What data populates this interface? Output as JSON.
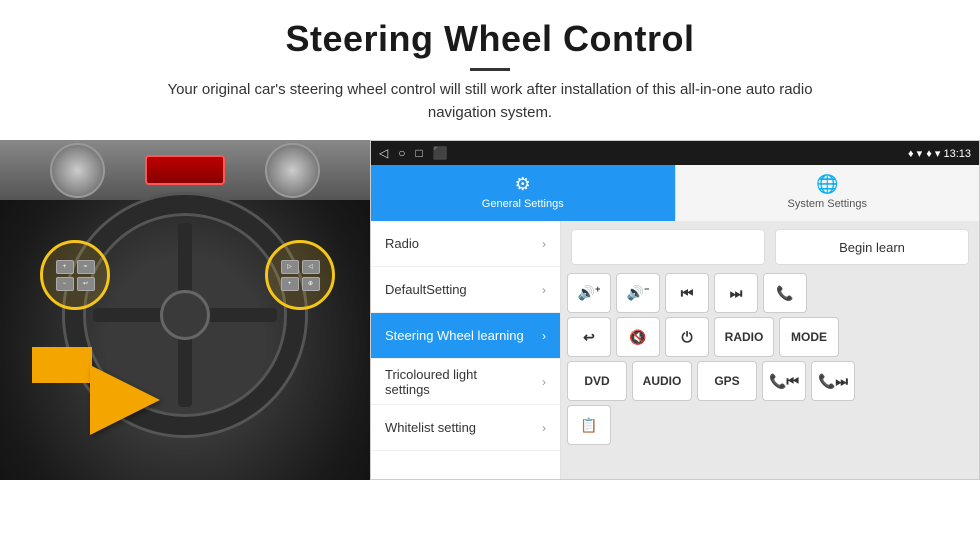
{
  "header": {
    "title": "Steering Wheel Control",
    "divider": true,
    "subtitle": "Your original car's steering wheel control will still work after installation of this all-in-one auto radio navigation system."
  },
  "android_ui": {
    "status_bar": {
      "nav_icons": [
        "◁",
        "○",
        "□",
        "⬛"
      ],
      "right": "♦ ▾ 13:13"
    },
    "tabs": [
      {
        "label": "General Settings",
        "icon": "⚙",
        "active": true
      },
      {
        "label": "System Settings",
        "icon": "🌐",
        "active": false
      }
    ],
    "menu_items": [
      {
        "label": "Radio",
        "active": false
      },
      {
        "label": "DefaultSetting",
        "active": false
      },
      {
        "label": "Steering Wheel learning",
        "active": true
      },
      {
        "label": "Tricoloured light settings",
        "active": false
      },
      {
        "label": "Whitelist setting",
        "active": false
      }
    ],
    "begin_learn_label": "Begin learn",
    "control_buttons": {
      "row1": [
        "🔊+",
        "🔊−",
        "⏮",
        "⏭",
        "📞"
      ],
      "row2": [
        "↩",
        "🔊✕",
        "⏻",
        "RADIO",
        "MODE"
      ],
      "row3": [
        "DVD",
        "AUDIO",
        "GPS",
        "📞⏮",
        "📞⏭"
      ],
      "row4": [
        "📋"
      ]
    }
  }
}
